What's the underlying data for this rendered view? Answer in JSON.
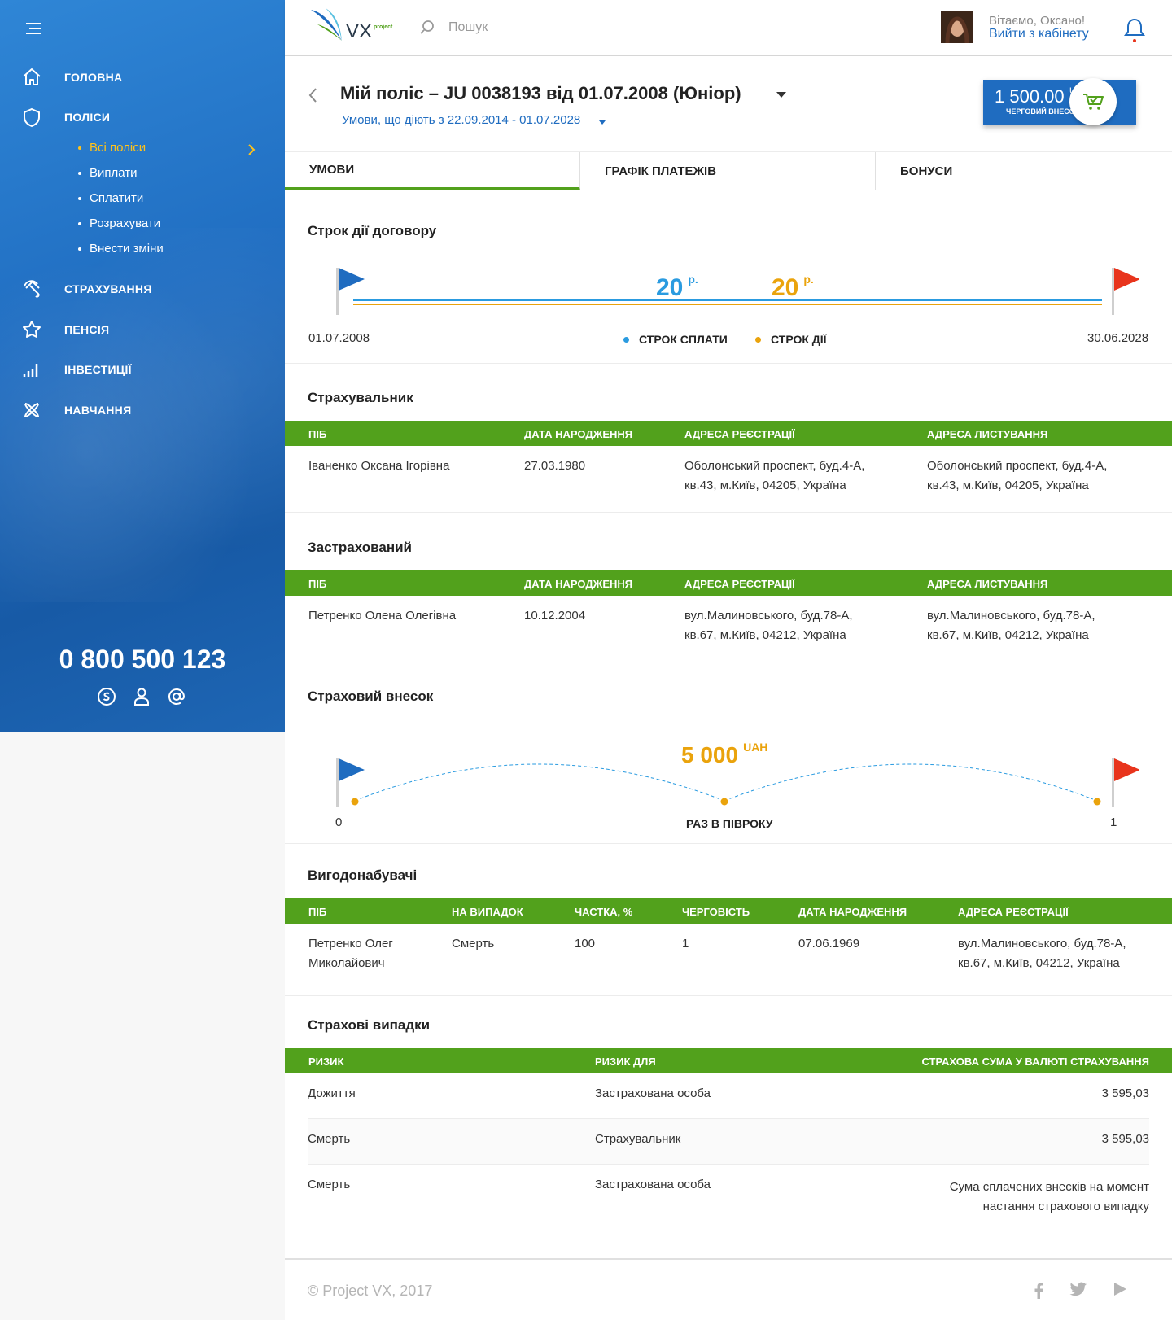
{
  "sidebar": {
    "nav": [
      {
        "label": "ГОЛОВНА",
        "icon": "home-icon"
      },
      {
        "label": "ПОЛІСИ",
        "icon": "shield-icon"
      },
      {
        "label": "СТРАХУВАННЯ",
        "icon": "umbrella-icon"
      },
      {
        "label": "ПЕНСІЯ",
        "icon": "star-icon"
      },
      {
        "label": "ІНВЕСТИЦІЇ",
        "icon": "chart-bars-icon"
      },
      {
        "label": "НАВЧАННЯ",
        "icon": "atom-icon"
      }
    ],
    "sub": [
      "Всі поліси",
      "Виплати",
      "Сплатити",
      "Розрахувати",
      "Внести зміни"
    ],
    "active_sub": "Всі поліси",
    "phone": "0 800 500 123",
    "contacts": [
      "skype-icon",
      "user-icon",
      "at-icon"
    ]
  },
  "header": {
    "logo_text": "VX",
    "logo_sub": "project",
    "search_placeholder": "Пошук",
    "greeting": "Вітаємо, Оксано!",
    "logout": "Вийти з кабінету"
  },
  "policy": {
    "title": "Мій поліс – JU 0038193 від 01.07.2008 (Юніор)",
    "terms": "Умови, що діють з 22.09.2014 - 01.07.2028",
    "payment": {
      "amount": "1 500.00",
      "currency": "UAH",
      "label": "ЧЕРГОВИЙ ВНЕСОК"
    }
  },
  "tabs": [
    "УМОВИ",
    "ГРАФІК ПЛАТЕЖІВ",
    "БОНУСИ"
  ],
  "term": {
    "title": "Строк дії договору",
    "pay_years": "20",
    "pay_unit": "р.",
    "valid_years": "20",
    "valid_unit": "р.",
    "start": "01.07.2008",
    "end": "30.06.2028",
    "legend_pay": "СТРОК СПЛАТИ",
    "legend_valid": "СТРОК ДІЇ",
    "colors": {
      "pay": "#2a9be0",
      "valid": "#eaa30c"
    }
  },
  "policyholder": {
    "title": "Страхувальник",
    "headers": [
      "ПІБ",
      "ДАТА НАРОДЖЕННЯ",
      "АДРЕСА РЕЄСТРАЦІЇ",
      "АДРЕСА ЛИСТУВАННЯ"
    ],
    "row": [
      "Іваненко Оксана Ігорівна",
      "27.03.1980",
      "Оболонський проспект, буд.4-А, кв.43, м.Київ, 04205, Україна",
      "Оболонський проспект, буд.4-А, кв.43, м.Київ, 04205, Україна"
    ]
  },
  "insured": {
    "title": "Застрахований",
    "headers": [
      "ПІБ",
      "ДАТА НАРОДЖЕННЯ",
      "АДРЕСА РЕЄСТРАЦІЇ",
      "АДРЕСА ЛИСТУВАННЯ"
    ],
    "row": [
      "Петренко Олена Олегівна",
      "10.12.2004",
      "вул.Малиновського, буд.78-А, кв.67, м.Київ, 04212, Україна",
      "вул.Малиновського, буд.78-А, кв.67, м.Київ, 04212, Україна"
    ]
  },
  "contribution": {
    "title": "Страховий внесок",
    "amount": "5 000",
    "currency": "UAH",
    "frequency": "РАЗ В ПІВРОКУ",
    "start": "0",
    "end": "1"
  },
  "beneficiaries": {
    "title": "Вигодонабувачі",
    "headers": [
      "ПІБ",
      "НА ВИПАДОК",
      "ЧАСТКА, %",
      "ЧЕРГОВІСТЬ",
      "ДАТА НАРОДЖЕННЯ",
      "АДРЕСА РЕЄСТРАЦІЇ"
    ],
    "row": [
      "Петренко Олег Миколайович",
      "Смерть",
      "100",
      "1",
      "07.06.1969",
      "вул.Малиновського, буд.78-А, кв.67, м.Київ, 04212, Україна"
    ]
  },
  "cases": {
    "title": "Страхові випадки",
    "headers": [
      "РИЗИК",
      "РИЗИК ДЛЯ",
      "СТРАХОВА СУМА У ВАЛЮТІ СТРАХУВАННЯ"
    ],
    "rows": [
      [
        "Дожиття",
        "Застрахована особа",
        "3 595,03"
      ],
      [
        "Смерть",
        "Страхувальник",
        "3 595,03"
      ],
      [
        "Смерть",
        "Застрахована особа",
        "Сума сплачених внесків на момент настання страхового випадку"
      ]
    ]
  },
  "footer": {
    "copyright": "© Project VX, 2017",
    "social": [
      "facebook-icon",
      "twitter-icon",
      "youtube-icon"
    ]
  }
}
